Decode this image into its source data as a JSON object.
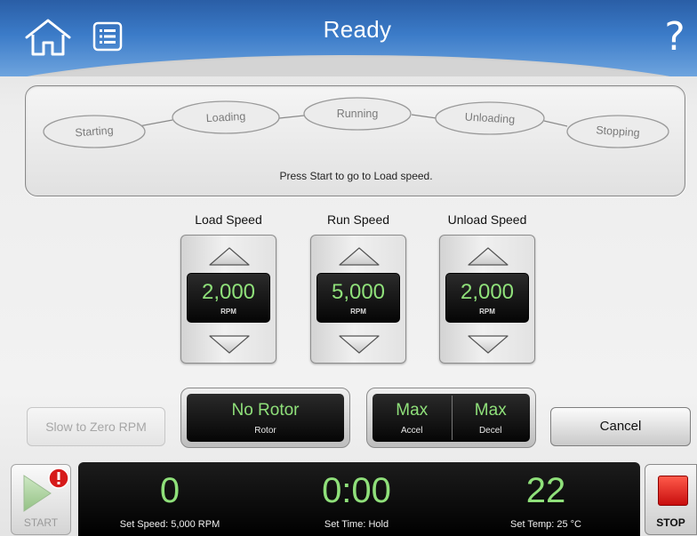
{
  "header": {
    "title": "Ready",
    "help_symbol": "?",
    "colors": {
      "bar_top": "#2a5ea6",
      "bar_bottom": "#6ea4de"
    }
  },
  "stages": {
    "items": [
      "Starting",
      "Loading",
      "Running",
      "Unloading",
      "Stopping"
    ],
    "hint": "Press Start to go to Load speed."
  },
  "speeds": {
    "load": {
      "label": "Load Speed",
      "value": "2,000",
      "unit": "RPM"
    },
    "run": {
      "label": "Run Speed",
      "value": "5,000",
      "unit": "RPM"
    },
    "unload": {
      "label": "Unload Speed",
      "value": "2,000",
      "unit": "RPM"
    }
  },
  "controls": {
    "slow_to_zero_label": "Slow to Zero RPM",
    "rotor": {
      "value": "No Rotor",
      "label": "Rotor"
    },
    "accel": {
      "value": "Max",
      "label": "Accel"
    },
    "decel": {
      "value": "Max",
      "label": "Decel"
    },
    "cancel_label": "Cancel"
  },
  "status": {
    "speed": {
      "value": "0",
      "label": "Set Speed: 5,000 RPM"
    },
    "time": {
      "value": "0:00",
      "label": "Set Time: Hold"
    },
    "temp": {
      "value": "22",
      "label": "Set Temp: 25 °C"
    }
  },
  "actions": {
    "start_label": "START",
    "stop_label": "STOP"
  },
  "icons": [
    "home-icon",
    "list-icon",
    "help-icon",
    "play-icon",
    "alert-badge-icon",
    "stop-icon",
    "arrow-up-icon",
    "arrow-down-icon"
  ],
  "colors": {
    "display_green": "#8fe07a",
    "stop_red": "#d91a1a",
    "alert_red": "#d61a1a"
  }
}
